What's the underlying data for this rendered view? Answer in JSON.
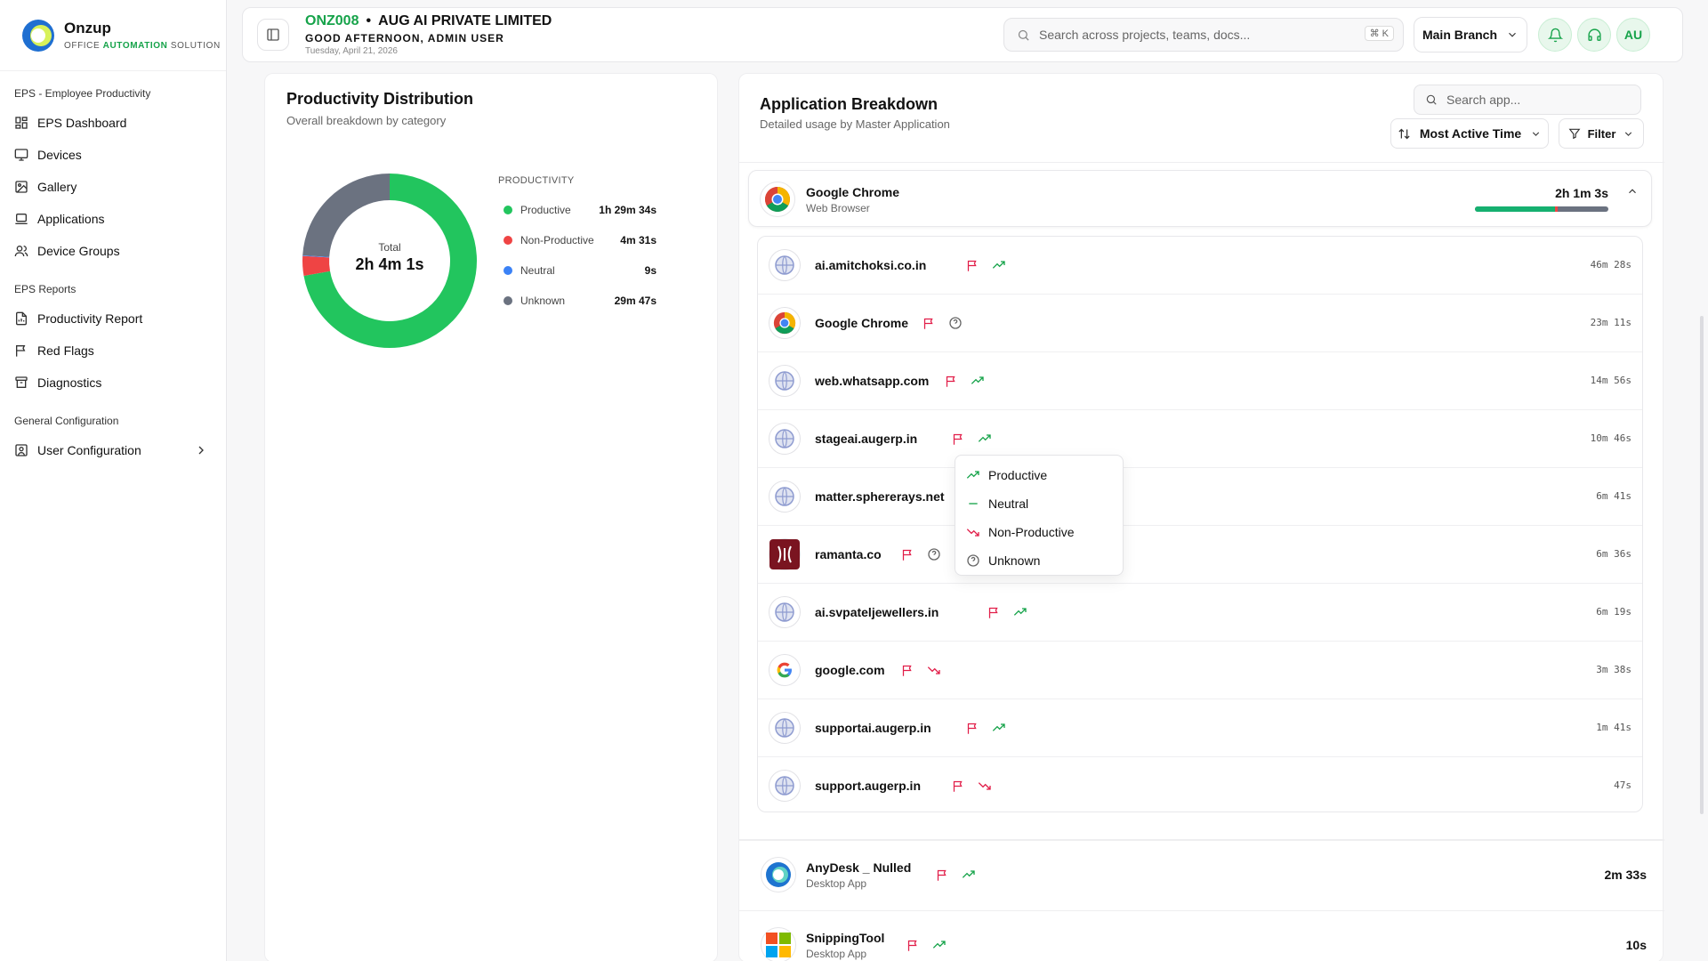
{
  "brand": {
    "name": "Onzup",
    "tag_pre": "OFFICE ",
    "tag_hl": "AUTOMATION",
    "tag_post": " SOLUTION"
  },
  "sidebar": {
    "sections": [
      {
        "title": "EPS - Employee Productivity",
        "items": [
          "EPS Dashboard",
          "Devices",
          "Gallery",
          "Applications",
          "Device Groups"
        ]
      },
      {
        "title": "EPS Reports",
        "items": [
          "Productivity Report",
          "Red Flags",
          "Diagnostics"
        ]
      },
      {
        "title": "General Configuration",
        "items": [
          "User Configuration"
        ]
      }
    ]
  },
  "header": {
    "org_code": "ONZ008",
    "separator": "•",
    "org_name": "AUG AI PRIVATE LIMITED",
    "greeting": "GOOD AFTERNOON, ADMIN USER",
    "date": "Tuesday, April 21, 2026",
    "search_placeholder": "Search across projects, teams, docs...",
    "search_shortcut": "⌘ K",
    "branch": "Main Branch",
    "avatar": "AU"
  },
  "productivity": {
    "title": "Productivity Distribution",
    "subtitle": "Overall breakdown by category",
    "center_label": "Total",
    "center_value": "2h 4m 1s",
    "legend_title": "PRODUCTIVITY",
    "legend": [
      {
        "label": "Productive",
        "value": "1h 29m 34s",
        "color": "#22c55e",
        "seconds": 5374
      },
      {
        "label": "Non-Productive",
        "value": "4m 31s",
        "color": "#ef4444",
        "seconds": 271
      },
      {
        "label": "Neutral",
        "value": "9s",
        "color": "#3b82f6",
        "seconds": 9
      },
      {
        "label": "Unknown",
        "value": "29m 47s",
        "color": "#6b7280",
        "seconds": 1787
      }
    ]
  },
  "apps": {
    "title": "Application Breakdown",
    "subtitle": "Detailed usage by Master Application",
    "search_placeholder": "Search app...",
    "sort_label": "Most Active Time",
    "filter_label": "Filter",
    "master": {
      "name": "Google Chrome",
      "type": "Web Browser",
      "time": "2h 1m 3s",
      "bar": {
        "productive": 0.6,
        "non_productive": 0.02
      }
    },
    "sub": [
      {
        "name": "ai.amitchoksi.co.in",
        "time": "46m 28s",
        "icon": "globe",
        "status": "productive"
      },
      {
        "name": "Google Chrome",
        "time": "23m 11s",
        "icon": "chrome",
        "status": "unknown"
      },
      {
        "name": "web.whatsapp.com",
        "time": "14m 56s",
        "icon": "globe",
        "status": "productive"
      },
      {
        "name": "stageai.augerp.in",
        "time": "10m 46s",
        "icon": "globe",
        "status": "productive"
      },
      {
        "name": "matter.sphererays.net",
        "time": "6m 41s",
        "icon": "globe",
        "status": "none"
      },
      {
        "name": "ramanta.co",
        "time": "6m 36s",
        "icon": "ramanta",
        "status": "unknown"
      },
      {
        "name": "ai.svpateljewellers.in",
        "time": "6m 19s",
        "icon": "globe",
        "status": "productive"
      },
      {
        "name": "google.com",
        "time": "3m 38s",
        "icon": "google",
        "status": "non-productive"
      },
      {
        "name": "supportai.augerp.in",
        "time": "1m 41s",
        "icon": "globe",
        "status": "productive"
      },
      {
        "name": "support.augerp.in",
        "time": "47s",
        "icon": "globe",
        "status": "non-productive"
      }
    ],
    "others": [
      {
        "name": "AnyDesk _ Nulled",
        "type": "Desktop App",
        "time": "2m 33s",
        "icon": "anydesk",
        "status": "productive"
      },
      {
        "name": "SnippingTool",
        "type": "Desktop App",
        "time": "10s",
        "icon": "windows",
        "status": "productive"
      }
    ]
  },
  "menu": {
    "items": [
      "Productive",
      "Neutral",
      "Non-Productive",
      "Unknown"
    ]
  }
}
